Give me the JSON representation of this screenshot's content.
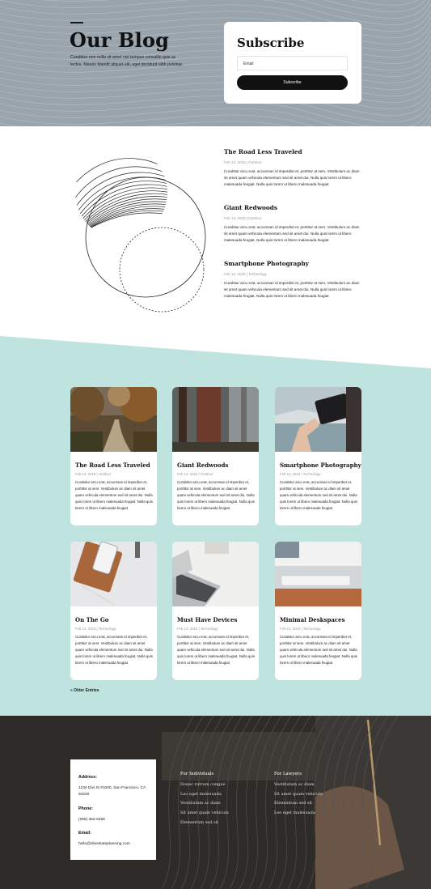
{
  "header": {
    "title": "Our Blog",
    "description": "Curabitur non nulla sit amet nisl tempus convallis quis ac lectus. Mauris blandit aliquet elit, eget tincidunt nibh pulvinar.",
    "subscribe_title": "Subscribe",
    "email_placeholder": "Email",
    "subscribe_button": "Subscribe"
  },
  "featured": [
    {
      "title": "The Road Less Traveled",
      "meta": "Feb 13, 2018 | Outdoor",
      "excerpt": "Curabitur arcu erat, accumsan id imperdiet et, porttitor at sem. Vestibulum ac diam sit amet quam vehicula elementum sed sit amet dui. Nulla quis lorem ut libero malesuada feugiat. Nulla quis lorem ut libero malesuada feugiat"
    },
    {
      "title": "Giant Redwoods",
      "meta": "Feb 13, 2018 | Outdoor",
      "excerpt": "Curabitur arcu erat, accumsan id imperdiet et, porttitor at sem. Vestibulum ac diam sit amet quam vehicula elementum sed sit amet dui. Nulla quis lorem ut libero malesuada feugiat. Nulla quis lorem ut libero malesuada feugiat"
    },
    {
      "title": "Smartphone Photography",
      "meta": "Feb 13, 2018 | Technology",
      "excerpt": "Curabitur arcu erat, accumsan id imperdiet et, porttitor at sem. Vestibulum ac diam sit amet quam vehicula elementum sed sit amet dui. Nulla quis lorem ut libero malesuada feugiat. Nulla quis lorem ut libero malesuada feugiat"
    }
  ],
  "cards": [
    {
      "title": "The Road Less Traveled",
      "meta": "Feb 13, 2018 | Outdoor",
      "excerpt": "Curabitur arcu erat, accumsan id imperdiet et, porttitor at sem. Vestibulum ac diam sit amet quam vehicula elementum sed sit amet dui. Nulla quis lorem ut libero malesuada feugiat. Nulla quis lorem ut libero malesuada feugiat"
    },
    {
      "title": "Giant Redwoods",
      "meta": "Feb 13, 2018 | Outdoor",
      "excerpt": "Curabitur arcu erat, accumsan id imperdiet et, porttitor at sem. Vestibulum ac diam sit amet quam vehicula elementum sed sit amet dui. Nulla quis lorem ut libero malesuada feugiat. Nulla quis lorem ut libero malesuada feugiat"
    },
    {
      "title": "Smartphone Photography",
      "meta": "Feb 13, 2018 | Technology",
      "excerpt": "Curabitur arcu erat, accumsan id imperdiet et, porttitor at sem. Vestibulum ac diam sit amet quam vehicula elementum sed sit amet dui. Nulla quis lorem ut libero malesuada feugiat. Nulla quis lorem ut libero malesuada feugiat"
    },
    {
      "title": "On The Go",
      "meta": "Feb 13, 2018 | Technology",
      "excerpt": "Curabitur arcu erat, accumsan id imperdiet et, porttitor at sem. Vestibulum ac diam sit amet quam vehicula elementum sed sit amet dui. Nulla quis lorem ut libero malesuada feugiat. Nulla quis lorem ut libero malesuada feugiat"
    },
    {
      "title": "Must Have Devices",
      "meta": "Feb 13, 2018 | Technology",
      "excerpt": "Curabitur arcu erat, accumsan id imperdiet et, porttitor at sem. Vestibulum ac diam sit amet quam vehicula elementum sed sit amet dui. Nulla quis lorem ut libero malesuada feugiat. Nulla quis lorem ut libero malesuada feugiat"
    },
    {
      "title": "Minimal Deskspaces",
      "meta": "Feb 13, 2018 | Technology",
      "excerpt": "Curabitur arcu erat, accumsan id imperdiet et, porttitor at sem. Vestibulum ac diam sit amet quam vehicula elementum sed sit amet dui. Nulla quis lorem ut libero malesuada feugiat. Nulla quis lorem ut libero malesuada feugiat"
    }
  ],
  "older_entries": "« Older Entries",
  "footer": {
    "address_label": "Address:",
    "address": "1234 Divi St #1000, San Francisco, CA 94220",
    "phone_label": "Phone:",
    "phone": "(255) 352-6258",
    "email_label": "Email:",
    "email": "hello@diviestateplanning.com",
    "col1_title": "For Individuals",
    "col1_links": [
      "Donec rutrum congue",
      "Leo eget malesuada",
      "Vestibulum ac diam",
      "Sit amet quam vehicula",
      "Elementum sed sit"
    ],
    "col2_title": "For Lawyers",
    "col2_links": [
      "Vestibulum ac diam",
      "Sit amet quam vehicula",
      "Elementum sed sit",
      "Leo eget malesuada"
    ]
  },
  "colors": {
    "header_bg": "#9aa4ad",
    "teal": "#bfe3de",
    "footer_bg": "#34302d",
    "accent": "#111111"
  }
}
